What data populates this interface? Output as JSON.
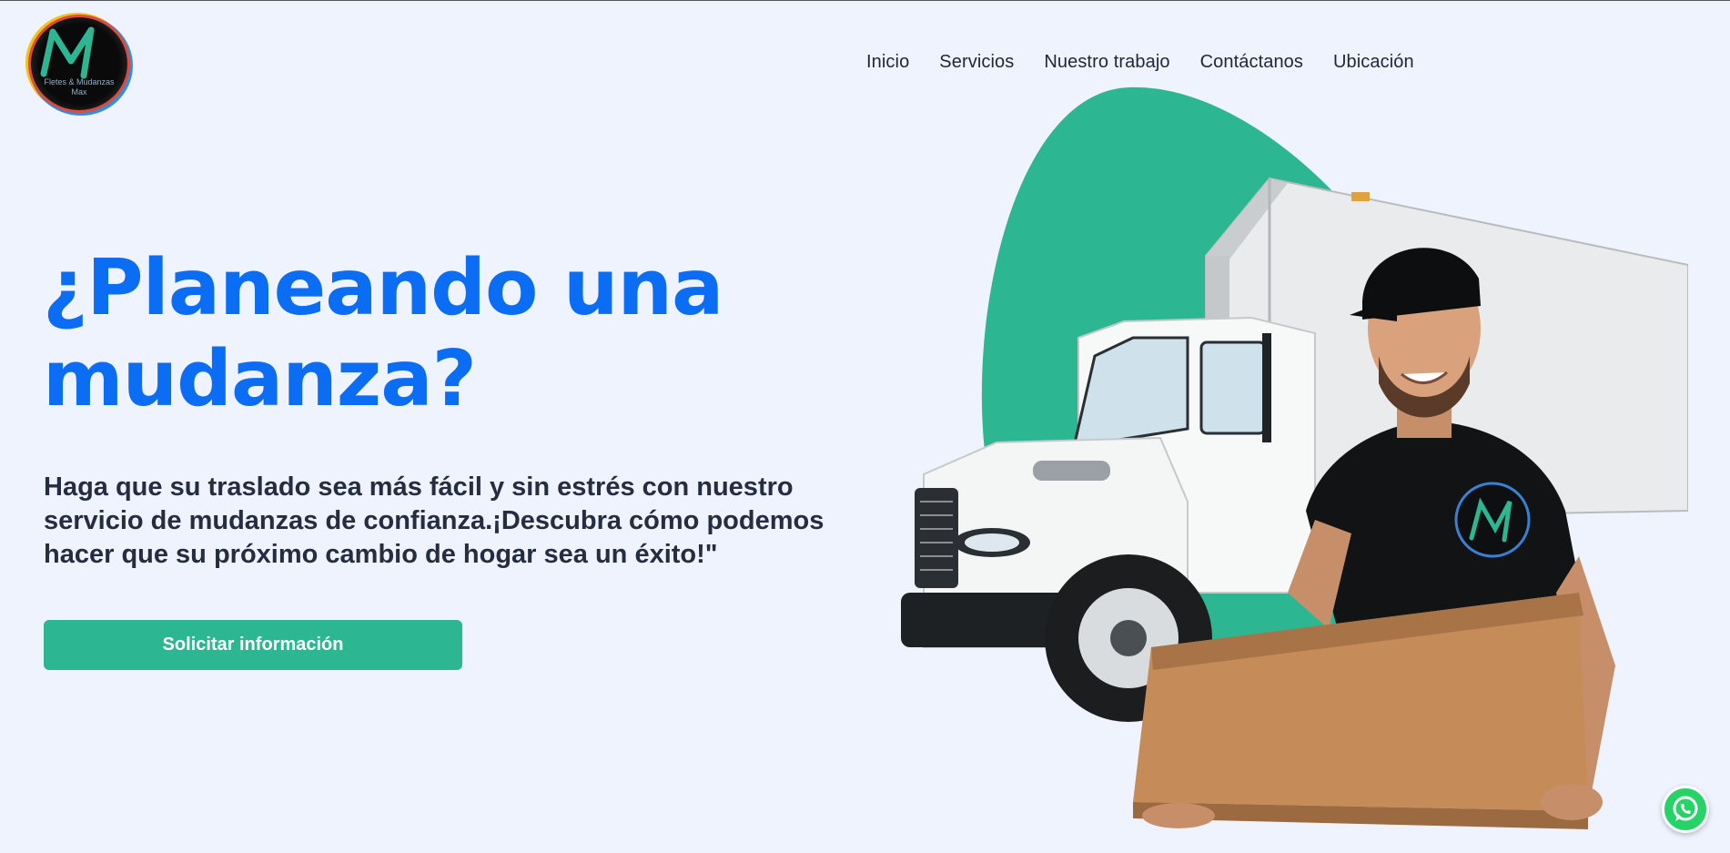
{
  "logo": {
    "line1": "Fletes & Mudanzas",
    "line2": "Max"
  },
  "nav": {
    "items": [
      {
        "label": "Inicio"
      },
      {
        "label": "Servicios"
      },
      {
        "label": "Nuestro trabajo"
      },
      {
        "label": "Contáctanos"
      },
      {
        "label": "Ubicación"
      }
    ]
  },
  "hero": {
    "title": "¿Planeando una mudanza?",
    "text": "Haga que su traslado sea más fácil y sin estrés con nuestro servicio de mudanzas de confianza.¡Descubra cómo podemos hacer que su próximo cambio de hogar sea un éxito!\"",
    "cta_label": "Solicitar información",
    "image_icon": "moving-truck-with-mover-illustration"
  },
  "floating": {
    "whatsapp_icon": "whatsapp-icon"
  },
  "colors": {
    "background": "#eff3fe",
    "title": "#0b6cf4",
    "accent": "#2cb692",
    "text": "#252d40"
  }
}
